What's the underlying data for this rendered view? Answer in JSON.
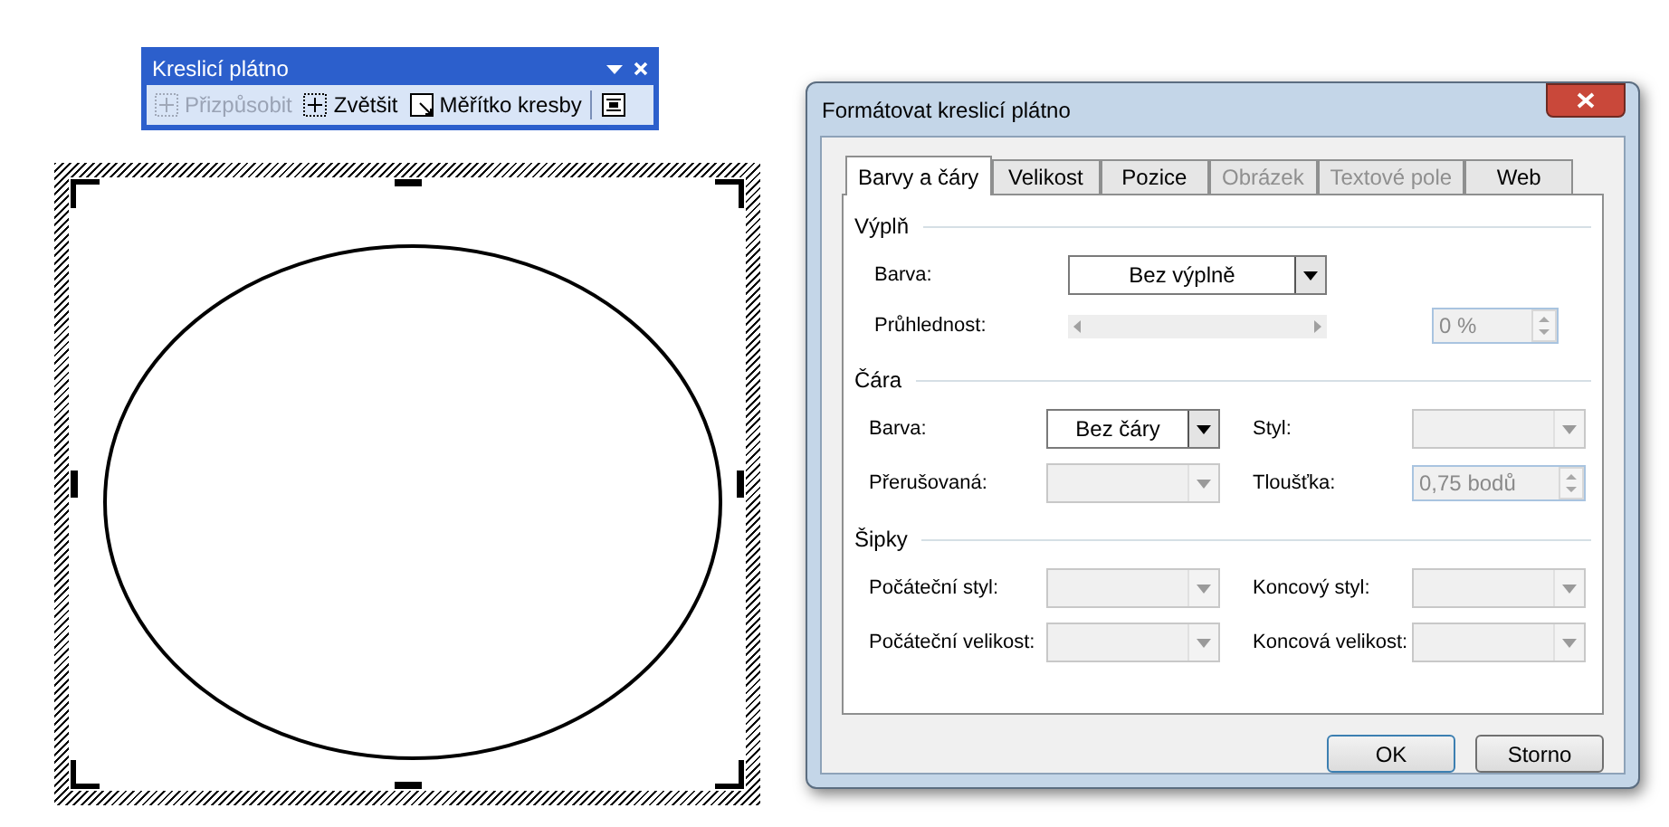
{
  "toolbar": {
    "title": "Kreslicí plátno",
    "buttons": [
      {
        "kind": "fit",
        "label": "Přizpůsobit",
        "disabled": true
      },
      {
        "kind": "expand",
        "label": "Zvětšit",
        "disabled": false
      },
      {
        "kind": "scale",
        "label": "Měřítko kresby",
        "disabled": false
      },
      {
        "kind": "wrap",
        "disabled": false
      }
    ]
  },
  "dialog": {
    "title": "Formátovat kreslicí plátno",
    "tabs": [
      {
        "label": "Barvy a čáry",
        "selected": true,
        "disabled": false
      },
      {
        "label": "Velikost",
        "selected": false,
        "disabled": false
      },
      {
        "label": "Pozice",
        "selected": false,
        "disabled": false
      },
      {
        "label": "Obrázek",
        "selected": false,
        "disabled": true
      },
      {
        "label": "Textové pole",
        "selected": false,
        "disabled": true
      },
      {
        "label": "Web",
        "selected": false,
        "disabled": false
      }
    ],
    "fill": {
      "title": "Výplň",
      "color": {
        "label": "Barva:",
        "value": "Bez výplně",
        "disabled": false
      },
      "transparency": {
        "label": "Průhlednost:",
        "reading": "0 %",
        "disabled": true
      }
    },
    "sections": [
      {
        "title": "Čára",
        "fields": [
          {
            "kind": "dropdown",
            "label": "Barva:",
            "value": "Bez čáry",
            "disabled": false
          },
          {
            "kind": "dropdown",
            "label": "Styl:",
            "disabled": true
          },
          {
            "kind": "dropdown",
            "label": "Přerušovaná:",
            "disabled": true
          },
          {
            "kind": "spinner",
            "label": "Tloušťka:",
            "value": "0,75 bodů",
            "disabled": true
          }
        ]
      },
      {
        "title": "Šipky",
        "fields": [
          {
            "kind": "dropdown",
            "label": "Počáteční styl:",
            "disabled": true
          },
          {
            "kind": "dropdown",
            "label": "Koncový styl:",
            "disabled": true
          },
          {
            "kind": "dropdown",
            "label": "Počáteční velikost:",
            "disabled": true
          },
          {
            "kind": "dropdown",
            "label": "Koncová velikost:",
            "disabled": true
          }
        ]
      }
    ],
    "buttons": [
      "OK",
      "Storno"
    ]
  }
}
